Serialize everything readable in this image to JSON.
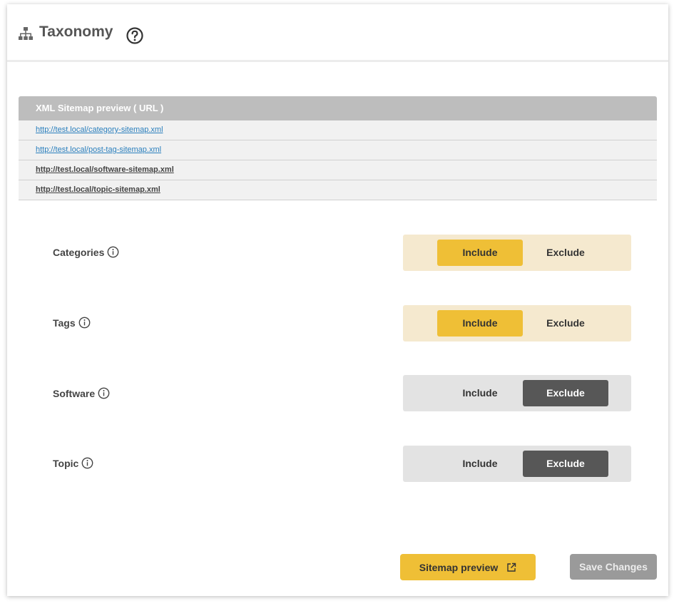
{
  "header": {
    "title": "Taxonomy",
    "icon": "sitemap-icon",
    "help_icon": "question-circle-icon"
  },
  "sitemap_table": {
    "heading": "XML Sitemap preview ( URL )",
    "rows": [
      {
        "url": "http://test.local/category-sitemap.xml",
        "style": "link"
      },
      {
        "url": "http://test.local/post-tag-sitemap.xml",
        "style": "link"
      },
      {
        "url": "http://test.local/software-sitemap.xml",
        "style": "bold"
      },
      {
        "url": "http://test.local/topic-sitemap.xml",
        "style": "bold"
      }
    ]
  },
  "options": [
    {
      "label": "Categories",
      "include_label": "Include",
      "exclude_label": "Exclude",
      "selected": "Include"
    },
    {
      "label": "Tags",
      "include_label": "Include",
      "exclude_label": "Exclude",
      "selected": "Include"
    },
    {
      "label": "Software",
      "include_label": "Include",
      "exclude_label": "Exclude",
      "selected": "Exclude"
    },
    {
      "label": "Topic",
      "include_label": "Include",
      "exclude_label": "Exclude",
      "selected": "Exclude"
    }
  ],
  "footer": {
    "preview_label": "Sitemap preview",
    "preview_icon": "external-link-icon",
    "save_label": "Save Changes"
  },
  "colors": {
    "accent": "#efbf36",
    "include_bg": "#f5e9cf",
    "exclude_active": "#575757",
    "link": "#2a7fbd"
  }
}
